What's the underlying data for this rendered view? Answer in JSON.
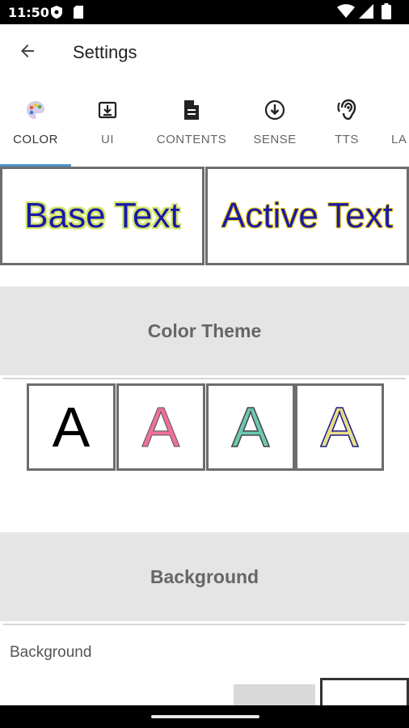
{
  "status_bar": {
    "time": "11:50",
    "left_icons": [
      "shield-icon",
      "sd-card-icon"
    ],
    "right_icons": [
      "wifi-icon",
      "signal-icon",
      "battery-icon"
    ]
  },
  "app_bar": {
    "back_icon": "arrow-left-icon",
    "title": "Settings"
  },
  "tabs": [
    {
      "label": "COLOR",
      "icon": "palette-icon",
      "active": true
    },
    {
      "label": "UI",
      "icon": "download-box-icon",
      "active": false
    },
    {
      "label": "CONTENTS",
      "icon": "document-icon",
      "active": false
    },
    {
      "label": "SENSE",
      "icon": "circle-arrow-down-icon",
      "active": false
    },
    {
      "label": "TTS",
      "icon": "hearing-icon",
      "active": false
    },
    {
      "label": "LA",
      "icon": "",
      "active": false
    }
  ],
  "preview": {
    "base_text": "Base Text",
    "active_text": "Active Text",
    "text_color": "#1a1aa6",
    "base_highlight": "#d4e66a",
    "active_outline": "#f2d21c"
  },
  "color_theme": {
    "header": "Color Theme",
    "options": [
      {
        "letter": "A",
        "fill": "#000000",
        "stroke": "none"
      },
      {
        "letter": "A",
        "fill": "#f0709a",
        "stroke": "#555555"
      },
      {
        "letter": "A",
        "fill": "#6cc9b2",
        "stroke": "#444444"
      },
      {
        "letter": "A",
        "fill": "#e8dd8a",
        "stroke": "#1a1a8a"
      }
    ]
  },
  "background": {
    "header": "Background",
    "label": "Background",
    "swatches": [
      "#d9d9d9",
      "#ffffff"
    ]
  },
  "colors": {
    "accent": "#4a90c8",
    "section_bg": "#e5e5e5"
  }
}
